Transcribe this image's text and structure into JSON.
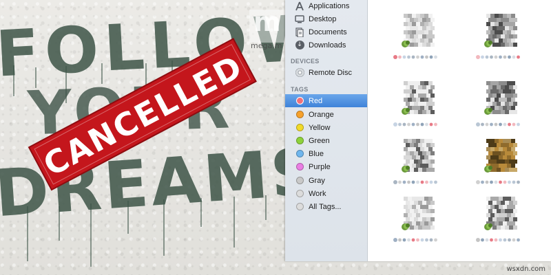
{
  "wallpaper": {
    "graffiti_top": "FOLLOW YOUR DREAMS",
    "banner_text": "CANCELLED",
    "banner_color": "#c4161c",
    "paint_color": "#3a5044",
    "watermark_text": "mega.m"
  },
  "sidebar": {
    "favorites": [
      {
        "label": "Applications",
        "icon": "applications-icon"
      },
      {
        "label": "Desktop",
        "icon": "desktop-icon"
      },
      {
        "label": "Documents",
        "icon": "documents-icon"
      },
      {
        "label": "Downloads",
        "icon": "downloads-icon"
      }
    ],
    "devices_header": "DEVICES",
    "devices": [
      {
        "label": "Remote Disc",
        "icon": "remote-disc-icon"
      }
    ],
    "tags_header": "TAGS",
    "tags": [
      {
        "label": "Red",
        "color": "#f0717a",
        "selected": true
      },
      {
        "label": "Orange",
        "color": "#f7a12c",
        "selected": false
      },
      {
        "label": "Yellow",
        "color": "#f1da2a",
        "selected": false
      },
      {
        "label": "Green",
        "color": "#8ed23b",
        "selected": false
      },
      {
        "label": "Blue",
        "color": "#6fb6ee",
        "selected": false
      },
      {
        "label": "Purple",
        "color": "#ea7ee3",
        "selected": false
      },
      {
        "label": "Gray",
        "color": "#c9c9c9",
        "selected": false
      },
      {
        "label": "Work",
        "color": "#dcdcdc",
        "selected": false
      },
      {
        "label": "All Tags...",
        "color": "#dcdcdc",
        "selected": false
      }
    ]
  },
  "files": [
    {
      "variant": "gray-light"
    },
    {
      "variant": "gray-dark"
    },
    {
      "variant": "gray-mixed"
    },
    {
      "variant": "gray-dark"
    },
    {
      "variant": "gray-mixed"
    },
    {
      "variant": "olive"
    },
    {
      "variant": "gray-light"
    },
    {
      "variant": "gray-mixed"
    }
  ],
  "footer": {
    "site_text": "wsxdn.com"
  }
}
